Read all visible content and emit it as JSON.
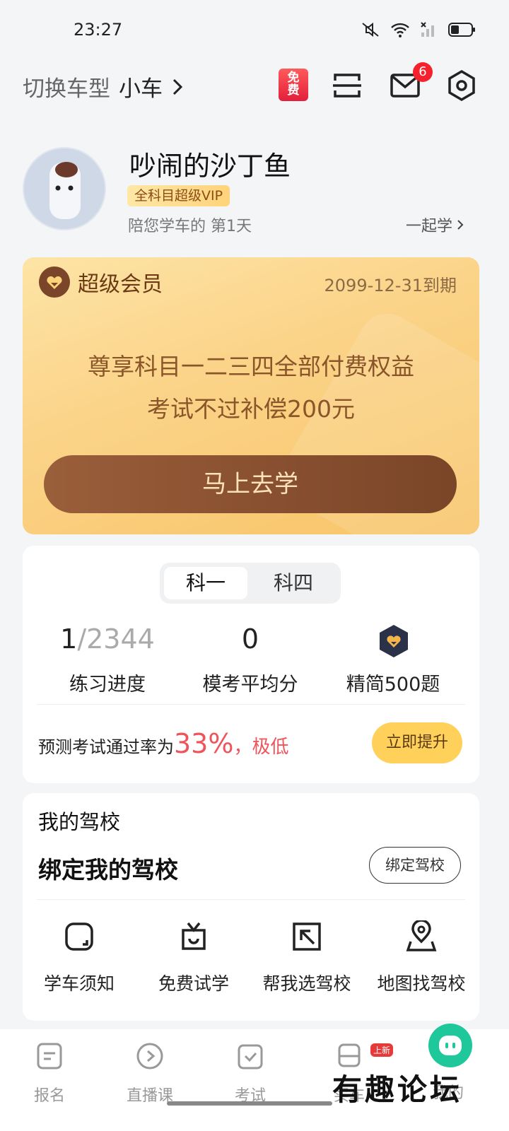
{
  "status": {
    "time": "23:27"
  },
  "header": {
    "switch_label": "切换车型",
    "car_type": "小车",
    "free_badge": "免费",
    "mail_count": "6"
  },
  "profile": {
    "username": "吵闹的沙丁鱼",
    "vip_tag": "全科目超级VIP",
    "study_days": "陪您学车的 第1天",
    "together": "一起学"
  },
  "vip_card": {
    "title": "超级会员",
    "expire": "2099-12-31到期",
    "line1": "尊享科目一二三四全部付费权益",
    "line2": "考试不过补偿200元",
    "button": "马上去学"
  },
  "progress": {
    "tabs": [
      "科一",
      "科四"
    ],
    "practice_done": "1",
    "practice_total": "/2344",
    "practice_label": "练习进度",
    "mock_avg": "0",
    "mock_label": "模考平均分",
    "essence_label": "精简500题",
    "predict_prefix": "预测考试通过率为",
    "predict_pct": "33%",
    "predict_suffix": "，极低",
    "improve_button": "立即提升"
  },
  "school": {
    "heading": "我的驾校",
    "bind_title": "绑定我的驾校",
    "bind_button": "绑定驾校",
    "features": [
      "学车须知",
      "免费试学",
      "帮我选驾校",
      "地图找驾校"
    ]
  },
  "bottom_nav": {
    "items": [
      "报名",
      "直播课",
      "考试",
      "买车",
      "我的"
    ],
    "new_tag": "上新"
  },
  "watermark": "有趣论坛",
  "colors": {
    "accent_red": "#f0545b",
    "gold_button": "#ffd05a",
    "brown_button": "#8a5030"
  }
}
